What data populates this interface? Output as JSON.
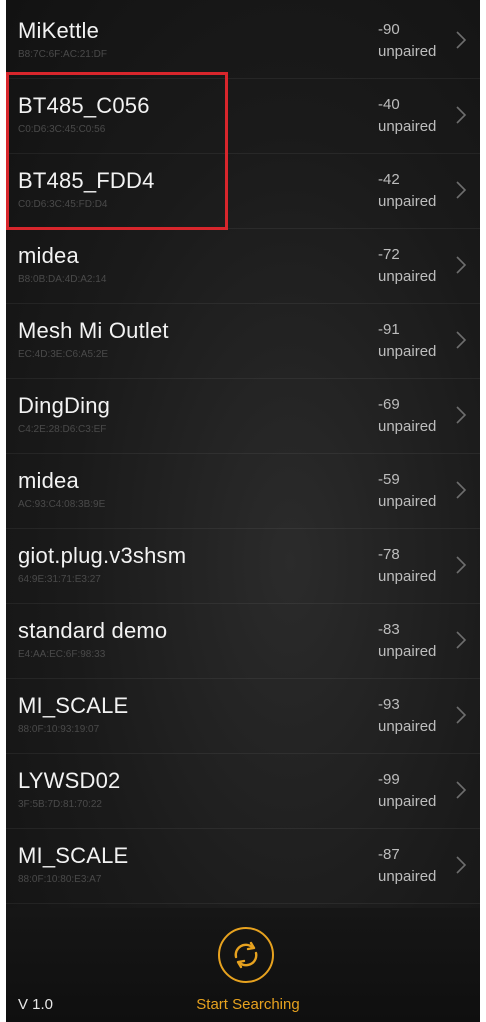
{
  "devices": [
    {
      "name": "MiKettle",
      "mac": "B8:7C:6F:AC:21:DF",
      "rssi": "-90",
      "status": "unpaired"
    },
    {
      "name": "BT485_C056",
      "mac": "C0:D6:3C:45:C0:56",
      "rssi": "-40",
      "status": "unpaired"
    },
    {
      "name": "BT485_FDD4",
      "mac": "C0:D6:3C:45:FD:D4",
      "rssi": "-42",
      "status": "unpaired"
    },
    {
      "name": "midea",
      "mac": "B8:0B:DA:4D:A2:14",
      "rssi": "-72",
      "status": "unpaired"
    },
    {
      "name": "Mesh Mi Outlet",
      "mac": "EC:4D:3E:C6:A5:2E",
      "rssi": "-91",
      "status": "unpaired"
    },
    {
      "name": "DingDing",
      "mac": "C4:2E:28:D6:C3:EF",
      "rssi": "-69",
      "status": "unpaired"
    },
    {
      "name": "midea",
      "mac": "AC:93:C4:08:3B:9E",
      "rssi": "-59",
      "status": "unpaired"
    },
    {
      "name": "giot.plug.v3shsm",
      "mac": "64:9E:31:71:E3:27",
      "rssi": "-78",
      "status": "unpaired"
    },
    {
      "name": "standard demo",
      "mac": "E4:AA:EC:6F:98:33",
      "rssi": "-83",
      "status": "unpaired"
    },
    {
      "name": "MI_SCALE",
      "mac": "88:0F:10:93:19:07",
      "rssi": "-93",
      "status": "unpaired"
    },
    {
      "name": "LYWSD02",
      "mac": "3F:5B:7D:81:70:22",
      "rssi": "-99",
      "status": "unpaired"
    },
    {
      "name": "MI_SCALE",
      "mac": "88:0F:10:80:E3:A7",
      "rssi": "-87",
      "status": "unpaired"
    }
  ],
  "footer": {
    "version": "V 1.0",
    "search_label": "Start Searching",
    "search_icon": "refresh-icon"
  },
  "colors": {
    "accent": "#e7a21f",
    "highlight_border": "#d8262c"
  }
}
